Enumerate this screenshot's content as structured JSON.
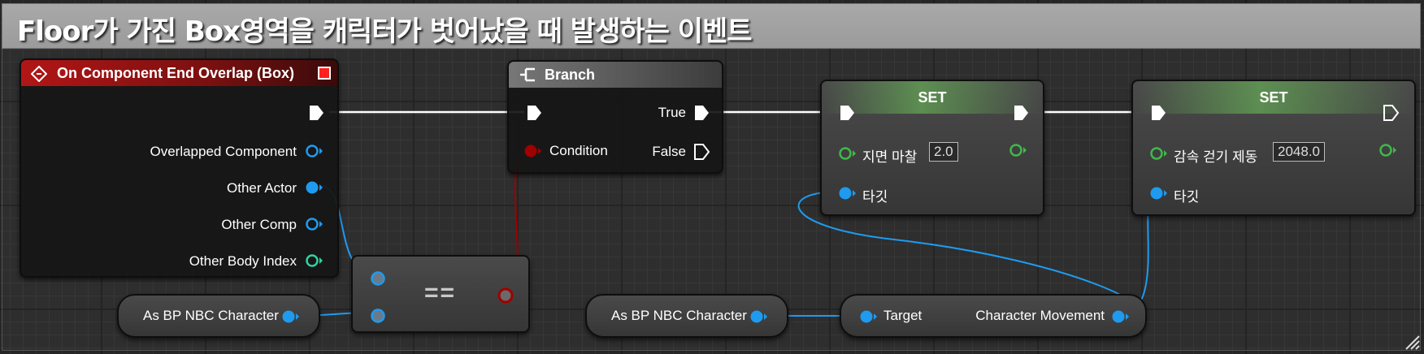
{
  "comment": {
    "title": "Floor가 가진 Box영역을 캐릭터가 벗어났을 때 발생하는 이벤트"
  },
  "event_node": {
    "title": "On Component End Overlap (Box)",
    "pins": [
      "Overlapped Component",
      "Other Actor",
      "Other Comp",
      "Other Body Index"
    ]
  },
  "branch_node": {
    "title": "Branch",
    "condition_label": "Condition",
    "true_label": "True",
    "false_label": "False"
  },
  "set_node_1": {
    "title": "SET",
    "var_label": "지면 마찰",
    "var_value": "2.0",
    "target_label": "타깃"
  },
  "set_node_2": {
    "title": "SET",
    "var_label": "감속 걷기 제동",
    "var_value": "2048.0",
    "target_label": "타깃"
  },
  "equal_node": {
    "label": "=="
  },
  "cast_node_1": {
    "label": "As BP NBC Character"
  },
  "cast_node_2": {
    "label": "As BP NBC Character"
  },
  "get_node": {
    "target_label": "Target",
    "output_label": "Character Movement"
  },
  "colors": {
    "exec": "#ffffff",
    "object": "#1e9bf0",
    "float": "#3fb94a",
    "bool": "#a00000",
    "int": "#2fd2a0",
    "event_header": "#b21616"
  }
}
